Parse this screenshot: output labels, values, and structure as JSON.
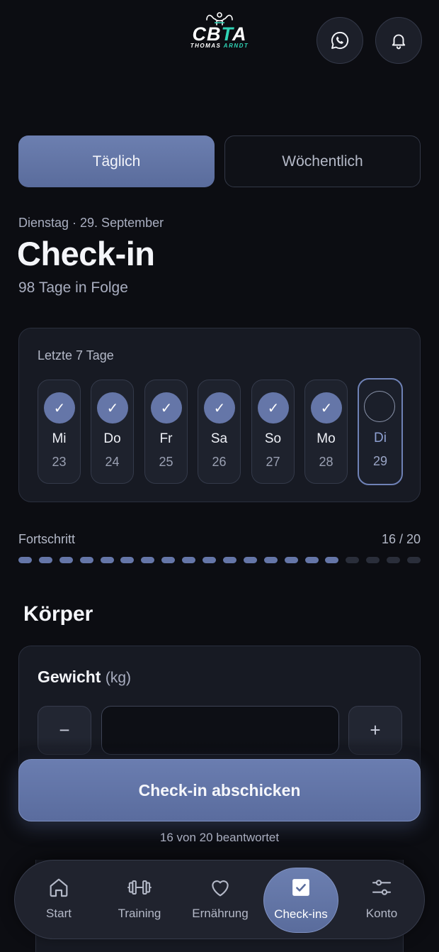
{
  "header": {
    "logo_main_left": "CB",
    "logo_main_accent": "T",
    "logo_main_right": "A",
    "logo_sub_left": "THOMAS",
    "logo_sub_accent": "ARNDT",
    "whatsapp_icon": "whatsapp-icon",
    "bell_icon": "bell-icon"
  },
  "tabs": [
    {
      "label": "Täglich",
      "active": true
    },
    {
      "label": "Wöchentlich",
      "active": false
    }
  ],
  "title_block": {
    "date": "Dienstag · 29. September",
    "title": "Check-in",
    "streak": "98 Tage in Folge"
  },
  "last_days": {
    "title": "Letzte 7 Tage",
    "days": [
      {
        "name": "Mi",
        "num": "23",
        "checked": true,
        "mark": "✓"
      },
      {
        "name": "Do",
        "num": "24",
        "checked": true,
        "mark": "✓"
      },
      {
        "name": "Fr",
        "num": "25",
        "checked": true,
        "mark": "✓"
      },
      {
        "name": "Sa",
        "num": "26",
        "checked": true,
        "mark": "✓"
      },
      {
        "name": "So",
        "num": "27",
        "checked": true,
        "mark": "✓"
      },
      {
        "name": "Mo",
        "num": "28",
        "checked": true,
        "mark": "✓"
      },
      {
        "name": "Di",
        "num": "29",
        "checked": false,
        "mark": ""
      }
    ]
  },
  "progress": {
    "label": "Fortschritt",
    "count": "16 / 20",
    "done": 16,
    "total": 20
  },
  "body_section": {
    "title": "Körper",
    "weight_label": "Gewicht",
    "weight_unit": "(kg)",
    "weight_value": "",
    "minus_label": "−",
    "plus_label": "+"
  },
  "submit": {
    "label": "Check-in abschicken",
    "note": "16 von 20 beantwortet"
  },
  "nav": [
    {
      "label": "Start",
      "icon": "home-icon",
      "active": false
    },
    {
      "label": "Training",
      "icon": "dumbbell-icon",
      "active": false
    },
    {
      "label": "Ernährung",
      "icon": "heart-icon",
      "active": false
    },
    {
      "label": "Check-ins",
      "icon": "checkbox-icon",
      "active": true
    },
    {
      "label": "Konto",
      "icon": "sliders-icon",
      "active": false
    }
  ],
  "colors": {
    "background": "#0c0d12",
    "accent": "#6576a8",
    "logo_accent": "#2fd3b5"
  }
}
